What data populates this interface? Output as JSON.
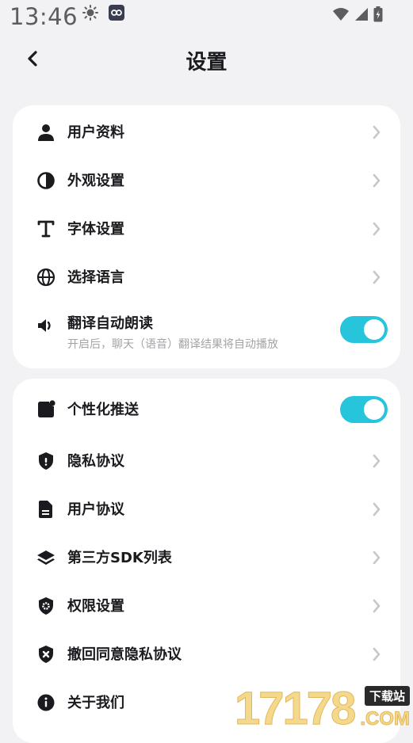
{
  "status_bar": {
    "time": "13:46"
  },
  "header": {
    "title": "设置"
  },
  "settings_group_1": [
    {
      "label": "用户资料",
      "icon": "user-icon"
    },
    {
      "label": "外观设置",
      "icon": "contrast-icon"
    },
    {
      "label": "字体设置",
      "icon": "font-icon"
    },
    {
      "label": "选择语言",
      "icon": "globe-icon"
    }
  ],
  "auto_read": {
    "label": "翻译自动朗读",
    "description": "开启后，聊天（语音）翻译结果将自动播放",
    "enabled": true,
    "icon": "speaker-icon"
  },
  "personalized_push": {
    "label": "个性化推送",
    "enabled": true,
    "icon": "notification-icon"
  },
  "settings_group_2": [
    {
      "label": "隐私协议",
      "icon": "shield-icon"
    },
    {
      "label": "用户协议",
      "icon": "document-icon"
    },
    {
      "label": "第三方SDK列表",
      "icon": "layers-icon"
    },
    {
      "label": "权限设置",
      "icon": "shield-gear-icon"
    },
    {
      "label": "撤回同意隐私协议",
      "icon": "shield-x-icon"
    },
    {
      "label": "关于我们",
      "icon": "info-icon"
    }
  ],
  "watermark": {
    "number": "17178",
    "badge": "下载站",
    "domain": ".COM"
  },
  "colors": {
    "accent": "#26c5db",
    "background": "#f2f2f4",
    "card": "#ffffff",
    "chevron": "#c8c8cc"
  }
}
